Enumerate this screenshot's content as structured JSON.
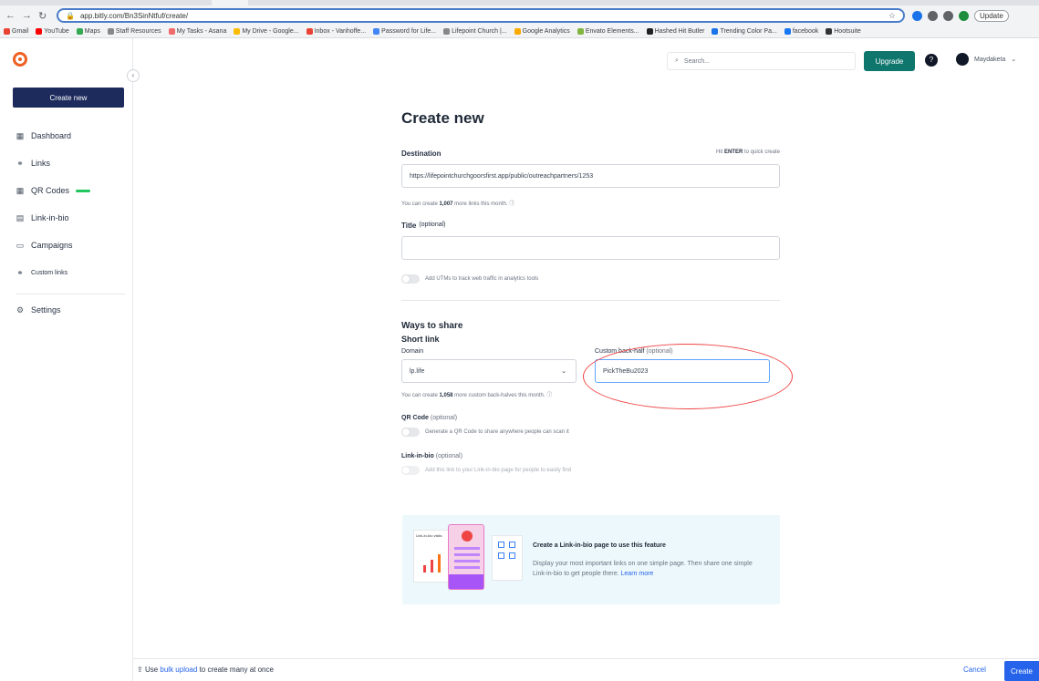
{
  "browser": {
    "url": "app.bitly.com/Bn3SinNtfuf/create/",
    "update_label": "Update",
    "bookmarks": [
      "Gmail",
      "YouTube",
      "Maps",
      "Staff Resources",
      "My Tasks - Asana",
      "My Drive - Google...",
      "Inbox - Vanhoffe...",
      "Password for Life...",
      "Lifepoint Church |...",
      "Google Analytics",
      "Envato Elements...",
      "Hashed Hit Butler",
      "Trending Color Pa...",
      "facebook",
      "Hootsuite"
    ]
  },
  "sidebar": {
    "create_label": "Create new",
    "items": [
      {
        "label": "Dashboard",
        "icon": "▦"
      },
      {
        "label": "Links",
        "icon": "⚭"
      },
      {
        "label": "QR Codes",
        "icon": "▦"
      },
      {
        "label": "Link-in-bio",
        "icon": "▤"
      },
      {
        "label": "Campaigns",
        "icon": "▭"
      },
      {
        "label": "Custom links",
        "icon": "⚭"
      }
    ],
    "settings_label": "Settings"
  },
  "topbar": {
    "search_placeholder": "Search...",
    "upgrade_label": "Upgrade",
    "account_name": "Maydaketa"
  },
  "form": {
    "title": "Create new",
    "destination_label": "Destination",
    "destination_hint_pre": "Hit",
    "destination_hint_key": "ENTER",
    "destination_hint_post": "to quick create",
    "destination_value": "https://lifepointchurchgoorsfirst.app/public/outreachpartners/1253",
    "links_left_pre": "You can create",
    "links_left_count": "1,007",
    "links_left_post": "more links this month.",
    "title_label": "Title",
    "title_optional": "(optional)",
    "utm_label": "Add UTMs to track web traffic in analytics tools",
    "ways_to_share": "Ways to share",
    "short_link_label": "Short link",
    "domain_label": "Domain",
    "domain_value": "lp.life",
    "back_half_label": "Custom back-half",
    "back_half_optional": "(optional)",
    "back_half_value": "PickTheBu2023",
    "back_half_left_pre": "You can create",
    "back_half_left_count": "1,058",
    "back_half_left_post": "more custom back-halves this month.",
    "qr_label": "QR Code",
    "qr_optional": "(optional)",
    "qr_toggle": "Generate a QR Code to share anywhere people can scan it",
    "lib_label": "Link-in-bio",
    "lib_optional": "(optional)",
    "lib_toggle": "Add this link to your Link-in-bio page for people to easily find"
  },
  "promo": {
    "card_header": "Link-in-bio visits",
    "title": "Create a Link-in-bio page to use this feature",
    "desc": "Display your most important links on one simple page. Then share one simple Link-in-bio to get people there.",
    "learn_more": "Learn more"
  },
  "footer": {
    "bulk_pre": "Use",
    "bulk_link": "bulk upload",
    "bulk_post": "to create many at once",
    "cancel_label": "Cancel",
    "create_label": "Create"
  },
  "colors": {
    "accent": "#2563eb",
    "sidebar_create": "#1d2a5c",
    "upgrade": "#0f766e",
    "annotation": "#ef4444"
  }
}
